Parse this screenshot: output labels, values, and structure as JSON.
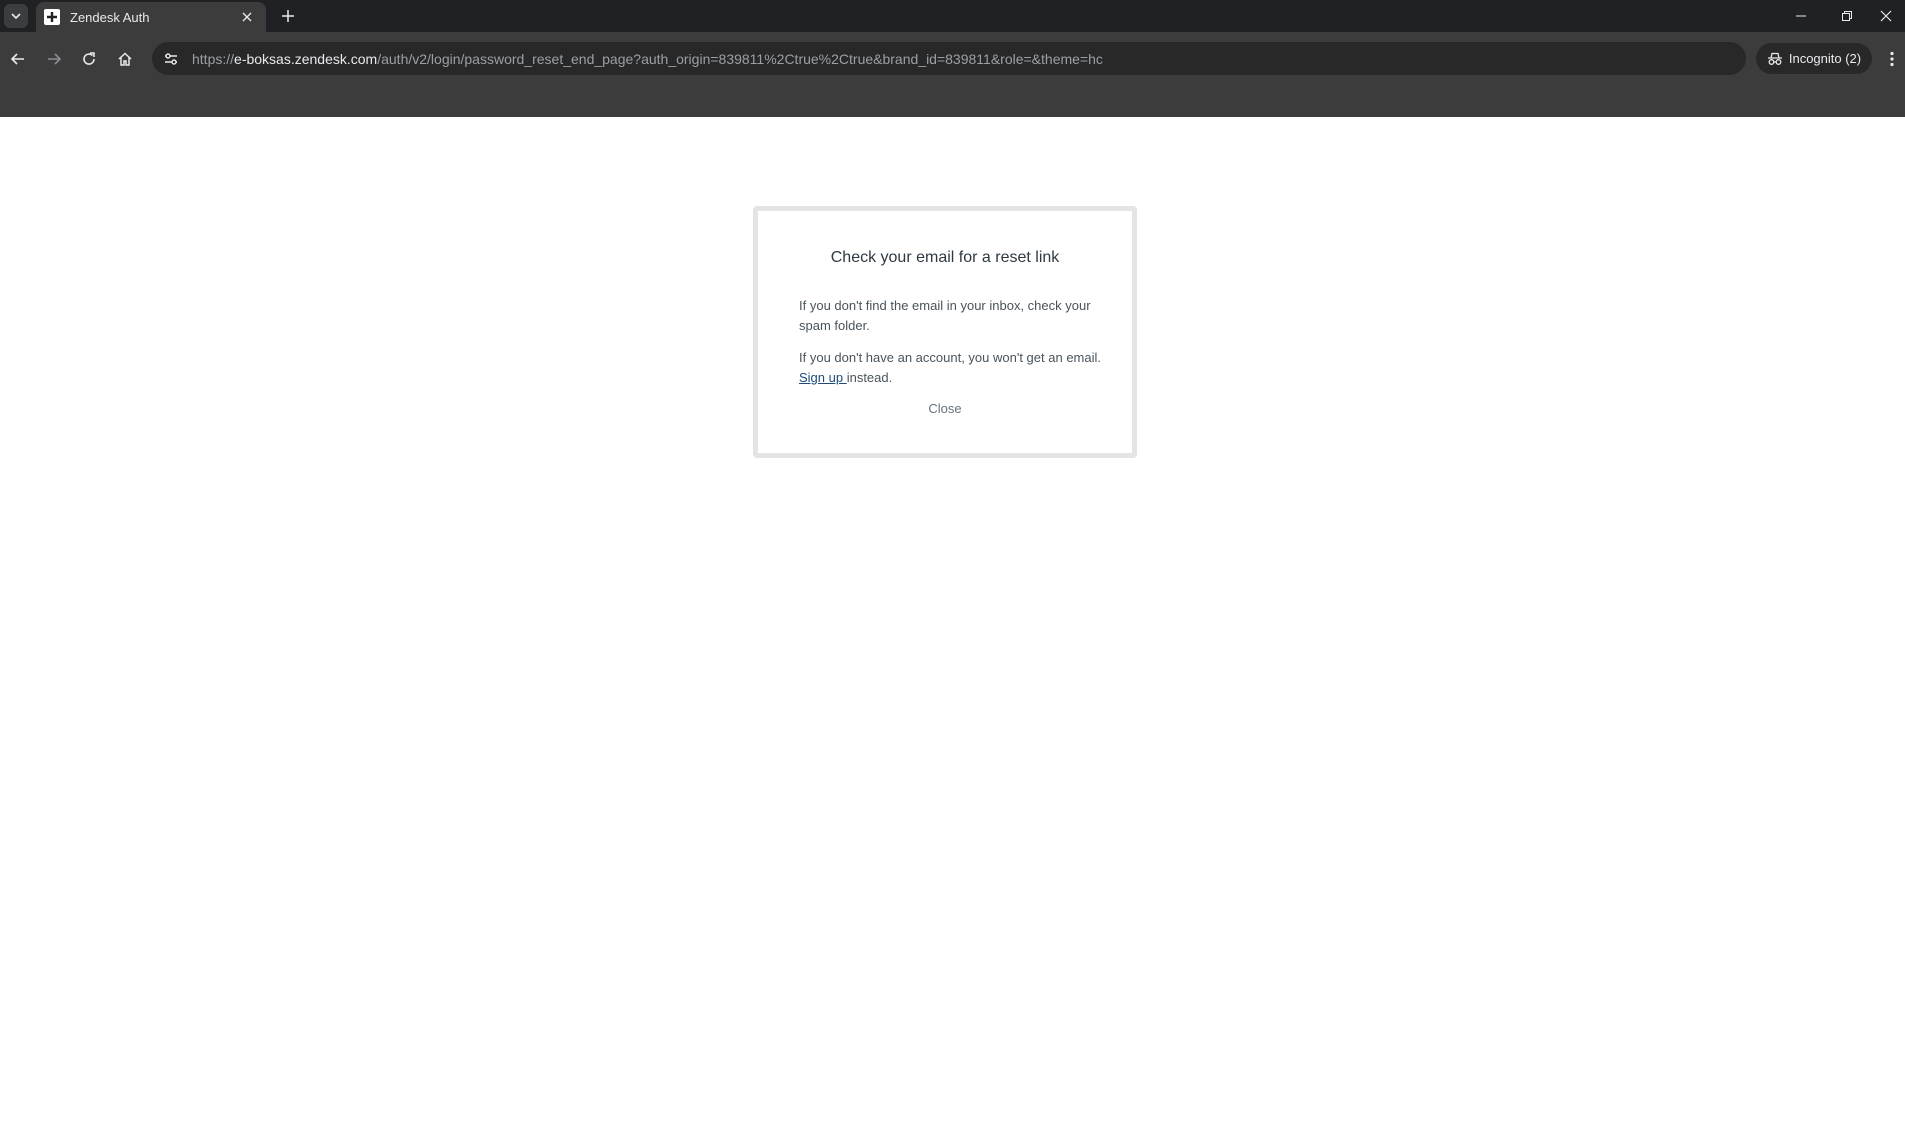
{
  "browser": {
    "tab": {
      "title": "Zendesk Auth"
    },
    "address_bar": {
      "url_scheme": "https://",
      "url_host": "e-boksas.zendesk.com",
      "url_path": "/auth/v2/login/password_reset_end_page?auth_origin=839811%2Ctrue%2Ctrue&brand_id=839811&role=&theme=hc"
    },
    "incognito_label": "Incognito (2)",
    "icons": {
      "tab_list": "chevron-down-icon",
      "favicon": "zendesk-plus-icon",
      "tab_close": "close-icon",
      "new_tab": "plus-icon",
      "minimize": "minimize-icon",
      "restore": "restore-icon",
      "close_window": "close-icon",
      "back": "arrow-left-icon",
      "forward": "arrow-right-icon",
      "reload": "reload-icon",
      "home": "home-icon",
      "site_info": "tune-icon",
      "incognito": "incognito-icon",
      "menu": "kebab-menu-icon"
    }
  },
  "dialog": {
    "title": "Check your email for a reset link",
    "paragraph1": "If you don't find the email in your inbox, check your spam folder.",
    "paragraph2_before": "If you don't have an account, you won't get an email. ",
    "signup_link": "Sign up ",
    "paragraph2_after": "instead.",
    "close_label": "Close"
  },
  "colors": {
    "chrome_dark": "#202124",
    "toolbar": "#3c3c3c",
    "omnibox": "#282828",
    "link": "#1e4b7a",
    "card_border": "#e4e4e4"
  }
}
